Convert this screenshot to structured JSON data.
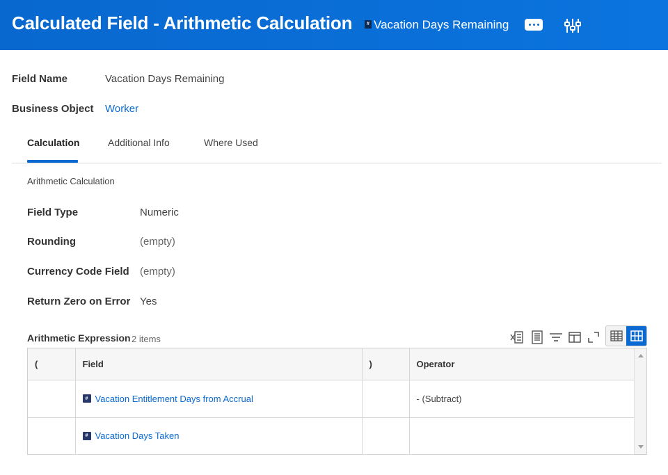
{
  "header": {
    "title": "Calculated Field - Arithmetic Calculation",
    "object_badge": "#",
    "object_name": "Vacation Days Remaining",
    "more_icon": "more-horizontal-icon",
    "related_icon": "related-actions-icon"
  },
  "info": {
    "field_name_label": "Field Name",
    "field_name_value": "Vacation Days Remaining",
    "business_object_label": "Business Object",
    "business_object_value": "Worker"
  },
  "tabs": [
    {
      "label": "Calculation",
      "active": true
    },
    {
      "label": "Additional Info",
      "active": false
    },
    {
      "label": "Where Used",
      "active": false
    }
  ],
  "section": {
    "title": "Arithmetic Calculation",
    "properties": [
      {
        "label": "Field Type",
        "value": "Numeric"
      },
      {
        "label": "Rounding",
        "value": "(empty)"
      },
      {
        "label": "Currency Code Field",
        "value": "(empty)"
      },
      {
        "label": "Return Zero on Error",
        "value": "Yes"
      }
    ]
  },
  "grid": {
    "title": "Arithmetic Expression",
    "count": "2 items",
    "toolbar_icons": [
      "export-excel-icon",
      "export-pdf-icon",
      "filter-icon",
      "columns-icon",
      "fullscreen-icon"
    ],
    "view_icons": [
      "table-view-icon",
      "grid-view-icon"
    ],
    "columns": [
      "(",
      "Field",
      ")",
      "Operator"
    ],
    "rows": [
      {
        "open": "",
        "field_badge": "#",
        "field": "Vacation Entitlement Days from Accrual",
        "close": "",
        "operator": "- (Subtract)"
      },
      {
        "open": "",
        "field_badge": "#",
        "field": "Vacation Days Taken",
        "close": "",
        "operator": ""
      }
    ]
  },
  "colors": {
    "brand_blue": "#0a6ad1",
    "link": "#0a6ad1",
    "badge_dark": "#26396a"
  }
}
